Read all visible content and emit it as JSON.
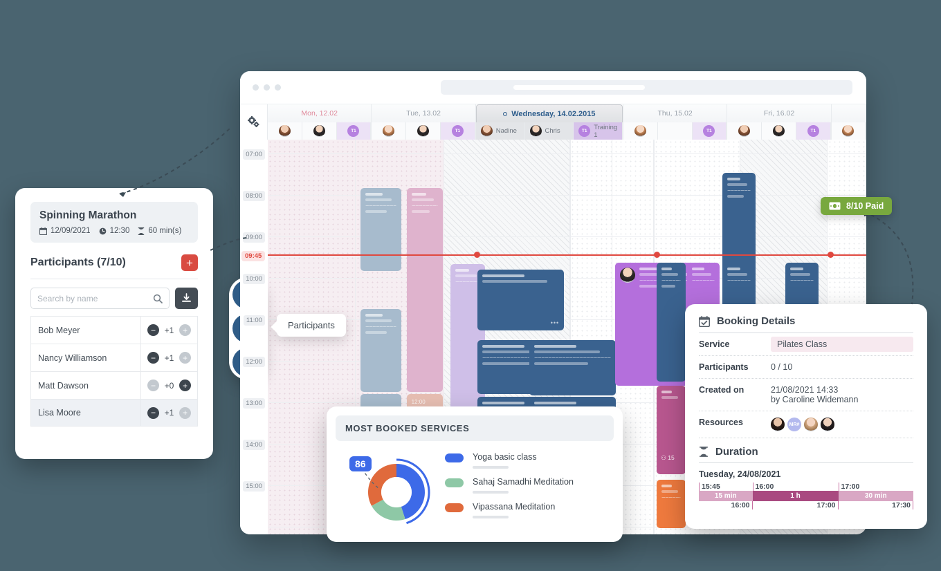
{
  "calendar": {
    "gear_icon": "settings-gears-icon",
    "days": [
      {
        "label": "Mon, 12.02",
        "style": "mon",
        "resources": [
          {
            "type": "avatar",
            "variant": "p1"
          },
          {
            "type": "avatar",
            "variant": "p2"
          },
          {
            "type": "training",
            "label": "T1"
          }
        ]
      },
      {
        "label": "Tue, 13.02",
        "style": "",
        "resources": [
          {
            "type": "avatar",
            "variant": "p3"
          },
          {
            "type": "avatar",
            "variant": "p2"
          },
          {
            "type": "training",
            "label": "T1"
          }
        ]
      },
      {
        "label": "Wednesday, 14.02.2015",
        "style": "active",
        "resources": [
          {
            "type": "named",
            "variant": "p1",
            "label": "Nadine"
          },
          {
            "type": "named",
            "variant": "p2",
            "label": "Chris"
          },
          {
            "type": "training-named",
            "label": "Training 1",
            "badge": "T1"
          }
        ]
      },
      {
        "label": "Thu, 15.02",
        "style": "",
        "resources": [
          {
            "type": "avatar",
            "variant": "p3"
          },
          {
            "type": "empty"
          },
          {
            "type": "training",
            "label": "T1"
          }
        ]
      },
      {
        "label": "Fri, 16.02",
        "style": "",
        "resources": [
          {
            "type": "avatar",
            "variant": "p1"
          },
          {
            "type": "avatar",
            "variant": "p2"
          },
          {
            "type": "training",
            "label": "T1"
          }
        ]
      },
      {
        "label": "",
        "style": "edge",
        "resources": [
          {
            "type": "avatar",
            "variant": "p3"
          }
        ]
      }
    ],
    "times": [
      "07:00",
      "08:00",
      "09:00",
      "10:00",
      "11:00",
      "12:00",
      "13:00",
      "14:00",
      "15:00"
    ],
    "now_time": "09:45",
    "now_color": "#e0483f",
    "event_time_label": "12:00",
    "event_participant_count": "15"
  },
  "paid_badge": {
    "label": "8/10 Paid",
    "icon": "banknote-icon",
    "color": "#78a83e"
  },
  "participants_panel": {
    "event_title": "Spinning Marathon",
    "date": "12/09/2021",
    "time": "12:30",
    "duration": "60 min(s)",
    "calendar_icon": "calendar-icon",
    "clock_icon": "clock-icon",
    "hourglass_icon": "hourglass-icon",
    "heading": "Participants (7/10)",
    "add_label": "+",
    "search_placeholder": "Search by name",
    "search_value": "",
    "search_icon": "search-icon",
    "download_icon": "download-icon",
    "rows": [
      {
        "name": "Bob Meyer",
        "count": "+1",
        "minus": "dark",
        "plus": "lite",
        "selected": false
      },
      {
        "name": "Nancy Williamson",
        "count": "+1",
        "minus": "dark",
        "plus": "lite",
        "selected": false
      },
      {
        "name": "Matt Dawson",
        "count": "+0",
        "minus": "lite",
        "plus": "dark",
        "selected": false
      },
      {
        "name": "Lisa Moore",
        "count": "+1",
        "minus": "dark",
        "plus": "lite",
        "selected": true
      }
    ]
  },
  "fabs": {
    "items": [
      {
        "icon": "eye-icon",
        "name": "view"
      },
      {
        "icon": "people-icon",
        "name": "participants"
      },
      {
        "icon": "pencil-icon",
        "name": "edit"
      }
    ],
    "tooltip": "Participants"
  },
  "most_booked": {
    "title": "MOST BOOKED SERVICES",
    "badge_value": "86",
    "badge_color": "#3d6ae8",
    "chart_data": {
      "type": "pie",
      "title": "MOST BOOKED SERVICES",
      "labels": [
        "Yoga basic class",
        "Sahaj Samadhi Meditation",
        "Vipassana Meditation"
      ],
      "values": [
        45,
        22,
        33
      ],
      "colors": [
        "#3d6ae8",
        "#8ec8a6",
        "#e06a3c"
      ],
      "annotation": "86",
      "legend": "right",
      "donut": true
    }
  },
  "booking_details": {
    "title": "Booking Details",
    "title_icon": "calendar-check-icon",
    "rows": [
      {
        "key": "Service",
        "value": "Pilates Class",
        "highlight": true
      },
      {
        "key": "Participants",
        "value": "0 / 10",
        "highlight": false
      },
      {
        "key": "Created on",
        "value": "21/08/2021 14:33\nby Caroline Widemann",
        "highlight": false
      }
    ],
    "resources_key": "Resources",
    "resources": [
      {
        "type": "photo",
        "variant": "r1"
      },
      {
        "type": "initials",
        "label": "MR#"
      },
      {
        "type": "photo",
        "variant": "r3"
      },
      {
        "type": "photo",
        "variant": "r4"
      }
    ],
    "duration_title": "Duration",
    "duration_icon": "hourglass-icon",
    "duration_date": "Tuesday, 24/08/2021",
    "segments": [
      {
        "start": "15:45",
        "label": "15 min",
        "end": "16:00",
        "tone": "lite",
        "weight": 25
      },
      {
        "start": "16:00",
        "label": "1 h",
        "end": "17:00",
        "tone": "dark",
        "weight": 40
      },
      {
        "start": "17:00",
        "label": "30 min",
        "end": "17:30",
        "tone": "lite",
        "weight": 35
      }
    ]
  }
}
